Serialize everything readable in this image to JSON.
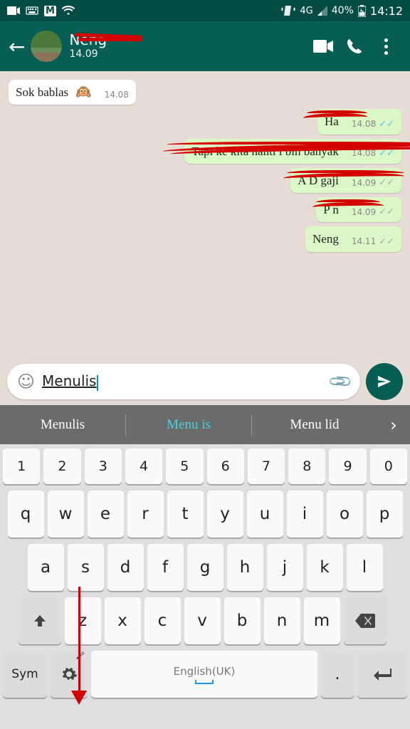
{
  "status": {
    "network": "4G",
    "battery": "40%",
    "time": "14:12"
  },
  "header": {
    "contact_name": "Neng",
    "last_seen": "14.09"
  },
  "messages": [
    {
      "dir": "in",
      "text": "Sok bablas",
      "time": "14.08",
      "read": ""
    },
    {
      "dir": "out",
      "text": "Ha",
      "time": "14.08",
      "read": "blue"
    },
    {
      "dir": "out",
      "text": "Tapi ke        kita nanti l bih banyak",
      "time": "14.08",
      "read": "blue"
    },
    {
      "dir": "out",
      "text": "A          D gaji",
      "time": "14.09",
      "read": "grey"
    },
    {
      "dir": "out",
      "text": "P        n",
      "time": "14.09",
      "read": "grey"
    },
    {
      "dir": "out",
      "text": "Neng",
      "time": "14.11",
      "read": "grey"
    }
  ],
  "input": {
    "text": "Menulis"
  },
  "suggestions": [
    "Menulis",
    "Menu is",
    "Menu lid"
  ],
  "keyboard": {
    "numbers": [
      "1",
      "2",
      "3",
      "4",
      "5",
      "6",
      "7",
      "8",
      "9",
      "0"
    ],
    "row1": [
      "q",
      "w",
      "e",
      "r",
      "t",
      "y",
      "u",
      "i",
      "o",
      "p"
    ],
    "row2": [
      "a",
      "s",
      "d",
      "f",
      "g",
      "h",
      "j",
      "k",
      "l"
    ],
    "row3": [
      "z",
      "x",
      "c",
      "v",
      "b",
      "n",
      "m"
    ],
    "sym": "Sym",
    "space": "English(UK)",
    "period": "."
  }
}
